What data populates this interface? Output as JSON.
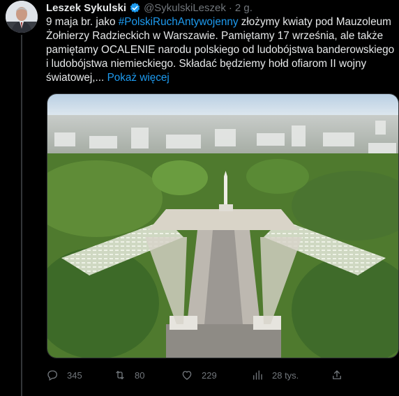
{
  "author": {
    "name": "Leszek Sykulski",
    "handle": "@SykulskiLeszek",
    "separator": "·",
    "time": "2 g.",
    "verified_color": "#1d9bf0"
  },
  "tweet": {
    "text_before": "9 maja br. jako ",
    "hashtag": "#PolskiRuchAntywojenny",
    "text_after": " złożymy kwiaty pod Mauzoleum Żołnierzy Radzieckich w Warszawie. Pamiętamy 17 września, ale także pamiętamy OCALENIE narodu polskiego od ludobójstwa banderowskiego i ludobójstwa niemieckiego. Składać będziemy hołd ofiarom II wojny światowej,...",
    "show_more": "Pokaż więcej"
  },
  "metrics": {
    "replies": "345",
    "retweets": "80",
    "likes": "229",
    "views": "28 tys."
  },
  "icons": {
    "reply": "reply-icon",
    "retweet": "retweet-icon",
    "like": "heart-icon",
    "views": "views-icon",
    "share": "share-icon"
  },
  "colors": {
    "background": "#000000",
    "text": "#e7e9ea",
    "muted": "#71767b",
    "accent": "#1d9bf0"
  }
}
